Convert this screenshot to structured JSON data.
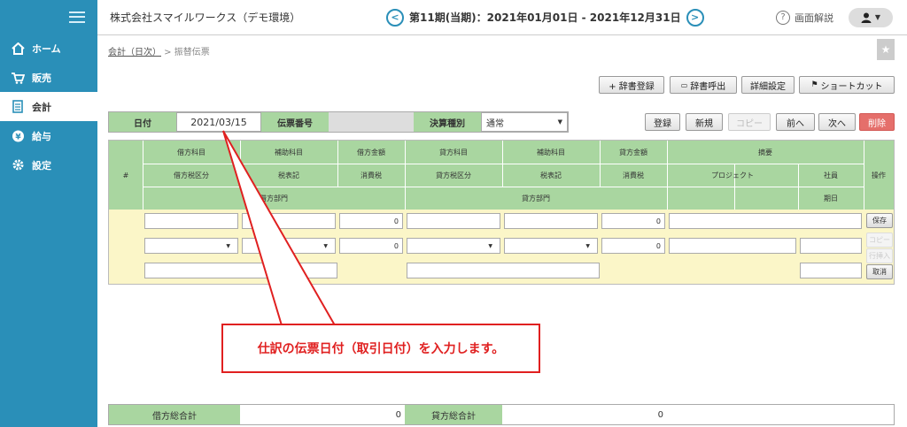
{
  "sidebar": {
    "items": [
      {
        "label": "ホーム",
        "icon": "home-icon"
      },
      {
        "label": "販売",
        "icon": "cart-icon"
      },
      {
        "label": "会計",
        "icon": "ledger-icon"
      },
      {
        "label": "給与",
        "icon": "coin-icon"
      },
      {
        "label": "設定",
        "icon": "gear-icon"
      }
    ],
    "active_index": 2
  },
  "header": {
    "company": "株式会社スマイルワークス（デモ環境）",
    "period": "第11期(当期)：2021年01月01日 - 2021年12月31日",
    "prev_glyph": "<",
    "next_glyph": ">",
    "help_label": "画面解説",
    "help_glyph": "?"
  },
  "breadcrumb": {
    "parent": "会計（日次）",
    "separator": " > ",
    "current": "振替伝票"
  },
  "toolbar": {
    "dict_register": "+ 辞書登録",
    "dict_call": "辞書呼出",
    "detail_settings": "詳細設定",
    "shortcut": "ショートカット"
  },
  "form": {
    "date_label": "日付",
    "date_value": "2021/03/15",
    "voucher_label": "伝票番号",
    "voucher_value": "",
    "settlement_label": "決算種別",
    "settlement_value": "通常"
  },
  "actions": {
    "register": "登録",
    "new": "新規",
    "copy": "コピー",
    "prev": "前へ",
    "next": "次へ",
    "delete": "削除"
  },
  "grid": {
    "hash": "#",
    "debit_account": "借方科目",
    "debit_sub": "補助科目",
    "debit_amount": "借方金額",
    "debit_tax_class": "借方税区分",
    "debit_tax_note": "税表記",
    "debit_tax": "消費税",
    "debit_dept": "借方部門",
    "credit_account": "貸方科目",
    "credit_sub": "補助科目",
    "credit_amount": "貸方金額",
    "credit_tax_class": "貸方税区分",
    "credit_tax_note": "税表記",
    "credit_tax": "消費税",
    "credit_dept": "貸方部門",
    "summary": "摘要",
    "project": "プロジェクト",
    "employee": "社員",
    "due_date": "期日",
    "operation": "操作",
    "row_debit_amount": "0",
    "row_debit_tax": "0",
    "row_credit_amount": "0",
    "row_credit_tax": "0",
    "save": "保存",
    "copy": "コピー",
    "insert": "行挿入",
    "cancel": "取消"
  },
  "callout": {
    "text": "仕訳の伝票日付（取引日付）を入力します。"
  },
  "totals": {
    "debit_label": "借方総合計",
    "debit_value": "0",
    "credit_label": "貸方総合計",
    "credit_value": "0"
  },
  "colors": {
    "sidebar": "#2a8fb8",
    "header_green": "#a9d6a0",
    "row_yellow": "#fbf6c8",
    "accent_red": "#e02020"
  }
}
